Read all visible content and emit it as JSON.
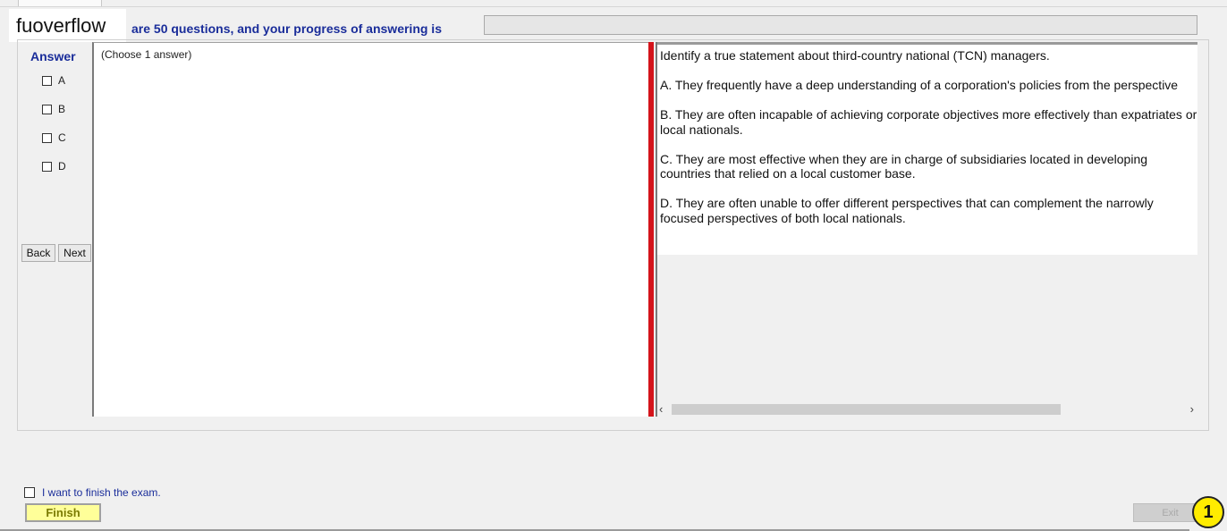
{
  "header": {
    "logo_text": "fuoverflow",
    "progress_text": "are 50 questions, and your progress of answering is",
    "progress_fraction": 0
  },
  "answer_panel": {
    "title": "Answer",
    "options": [
      "A",
      "B",
      "C",
      "D"
    ],
    "back_label": "Back",
    "next_label": "Next",
    "choose_note": "(Choose 1 answer)"
  },
  "question": {
    "stem": "Identify a true statement about third-country national (TCN) managers.",
    "choices": [
      "A.  They frequently have a deep understanding of a corporation's policies from the perspective",
      "B.  They are often incapable of achieving corporate objectives more effectively than expatriates or local nationals.",
      "C.  They are most effective when they are in charge of subsidiaries located in developing countries that relied on a local customer base.",
      "D.  They are often unable to offer different perspectives that can complement the narrowly focused perspectives of both local nationals."
    ]
  },
  "footer": {
    "finish_check_label": "I want to finish the exam.",
    "finish_label": "Finish",
    "exit_label": "Exit",
    "badge": "1"
  },
  "colors": {
    "accent_text": "#1a2d9a",
    "splitter": "#d4141b",
    "finish_bg": "#ffff99",
    "badge_bg": "#ffec00"
  }
}
